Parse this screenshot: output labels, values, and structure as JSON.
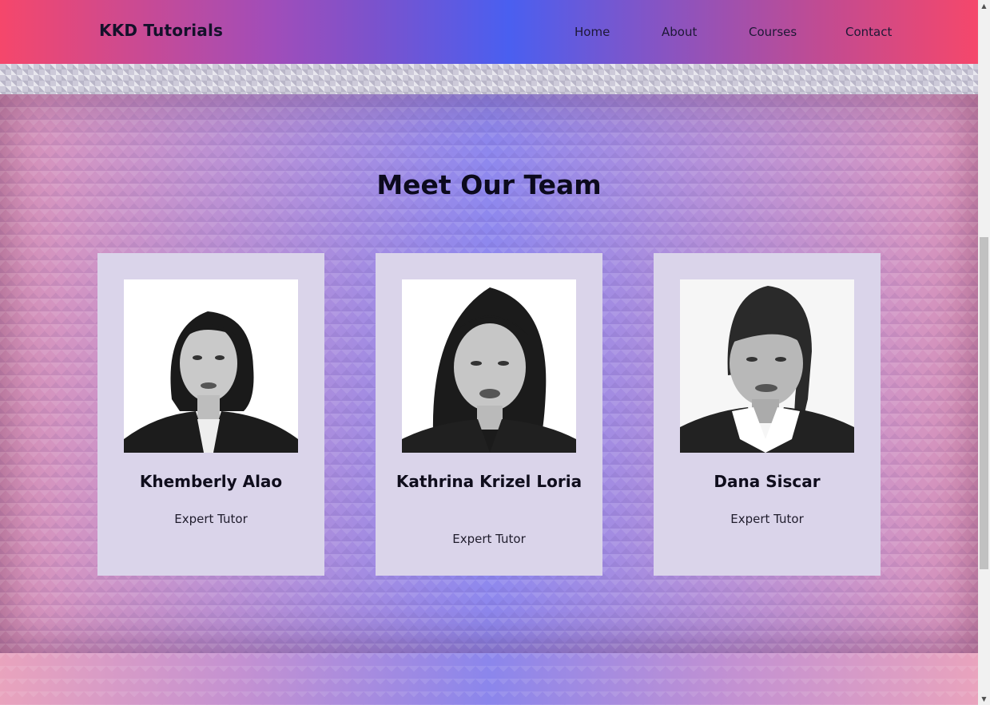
{
  "navbar": {
    "brand": "KKD Tutorials",
    "items": [
      {
        "label": "Home"
      },
      {
        "label": "About"
      },
      {
        "label": "Courses"
      },
      {
        "label": "Contact"
      }
    ]
  },
  "team": {
    "title": "Meet Our Team",
    "members": [
      {
        "name": "Khemberly Alao",
        "role": "Expert Tutor"
      },
      {
        "name": "Kathrina Krizel Loria",
        "role": "Expert Tutor"
      },
      {
        "name": "Dana Siscar",
        "role": "Expert Tutor"
      }
    ]
  },
  "colors": {
    "nav_gradient_edge": "#f5476b",
    "nav_gradient_center": "#4a5ff0",
    "card_background": "#dad4ea"
  }
}
